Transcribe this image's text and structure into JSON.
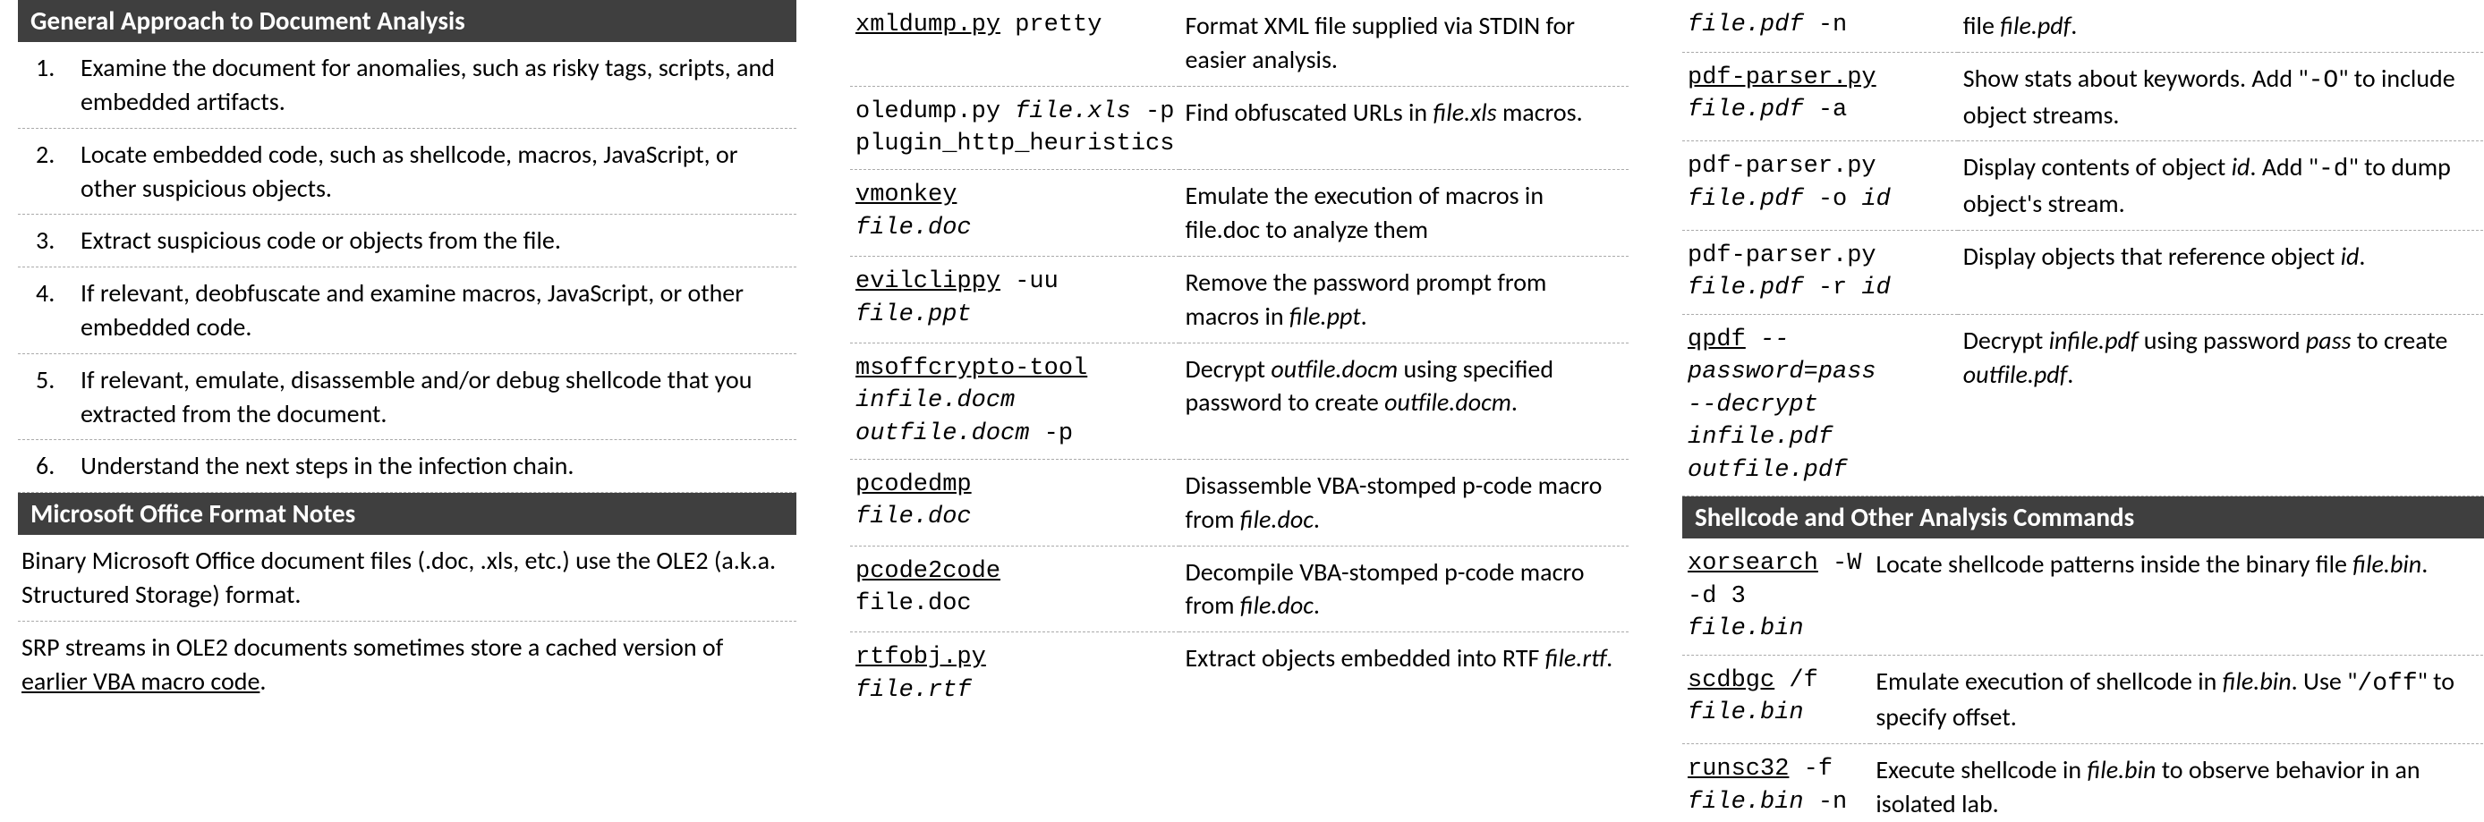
{
  "col1": {
    "header1": "General Approach to Document Analysis",
    "steps": [
      "Examine the document for anomalies, such as risky tags, scripts, and embedded artifacts.",
      "Locate embedded code, such as shellcode, macros, JavaScript, or other suspicious objects.",
      "Extract suspicious code or objects from the file.",
      "If relevant, deobfuscate and examine macros, JavaScript, or other embedded code.",
      "If relevant, emulate, disassemble and/or debug shellcode that you extracted from the document.",
      "Understand the next steps in the infection chain."
    ],
    "header2": "Microsoft Office Format Notes",
    "note1": "Binary Microsoft Office document files (.doc, .xls, etc.) use the OLE2 (a.k.a. Structured Storage) format.",
    "note2_a": "SRP streams in OLE2 documents sometimes store a cached version of ",
    "note2_link": "earlier VBA macro code",
    "note2_b": "."
  },
  "col2": {
    "rows": [
      {
        "tool": "xmldump.py",
        "rest": " pretty",
        "desc": "Format XML file supplied via STDIN for easier analysis."
      },
      {
        "tool": "",
        "plain": "oledump.py ",
        "arg1": "file.xls",
        "rest1": " -p \nplugin_http_heuristics",
        "desc_a": "Find obfuscated URLs in ",
        "desc_em": "file.xls",
        "desc_b": " macros."
      },
      {
        "tool": "vmonkey",
        "rest": "",
        "line2_arg": "file.doc",
        "desc": "Emulate the execution of macros in file.doc to analyze them"
      },
      {
        "tool": "evilclippy",
        "rest": " -uu",
        "line2_arg": "file.ppt",
        "desc_a": "Remove the password prompt from macros in ",
        "desc_em": "file.ppt",
        "desc_b": "."
      },
      {
        "tool": "msoffcrypto-tool",
        "rest": "",
        "line2_arg": "infile.docm",
        "line3_arg": "outfile.docm",
        "line3_rest": " -p",
        "desc_a": "Decrypt ",
        "desc_em": "outfile.docm",
        "desc_b": " using specified password to create ",
        "desc_em2": "outfile.docm",
        "desc_c": "."
      },
      {
        "tool": "pcodedmp",
        "rest": "",
        "line2_arg": "file.doc",
        "desc_a": "Disassemble VBA-stomped p-code macro from ",
        "desc_em": "file.doc",
        "desc_b": "."
      },
      {
        "tool": "pcode2code",
        "rest": "",
        "line2_plain": "file.doc",
        "desc_a": "Decompile VBA-stomped p-code macro from ",
        "desc_em": "file.doc",
        "desc_b": "."
      },
      {
        "tool": "rtfobj.py",
        "rest": "",
        "line2_arg": "file.rtf",
        "desc_a": "Extract objects embedded into RTF ",
        "desc_em": "file.rtf",
        "desc_b": "."
      }
    ]
  },
  "col3": {
    "top_partial": {
      "cmd_arg": "file.pdf",
      "cmd_rest": " -n",
      "desc_a": "file ",
      "desc_em": "file.pdf",
      "desc_b": "."
    },
    "pdf_rows": [
      {
        "tool": "pdf-parser.py",
        "line2_arg": "file.pdf",
        "line2_rest": " -a",
        "desc_a": "Show stats about keywords. Add \"",
        "desc_mono": "-O",
        "desc_b": "\" to include object streams."
      },
      {
        "plain": "pdf-parser.py",
        "line2_arg": "file.pdf",
        "line2_rest": " -o ",
        "line2_arg2": "id",
        "desc_a": "Display contents of object ",
        "desc_em": "id",
        "desc_b": ". Add \"",
        "desc_mono": "-d",
        "desc_c": "\" to dump object's stream."
      },
      {
        "plain": "pdf-parser.py",
        "line2_arg": "file.pdf",
        "line2_rest": " -r ",
        "line2_arg2": "id",
        "desc_a": "Display objects that reference object ",
        "desc_em": "id",
        "desc_b": "."
      },
      {
        "tool": "qpdf",
        "rest_arg": " --password=pass",
        "line2_arg": "--decrypt infile.pdf",
        "line3_arg": "outfile.pdf",
        "desc_a": "Decrypt ",
        "desc_em": "infile.pdf",
        "desc_b": " using password ",
        "desc_em2": "pass",
        "desc_c": " to create ",
        "desc_em3": "outfile.pdf",
        "desc_d": "."
      }
    ],
    "header": "Shellcode and Other Analysis Commands",
    "shell_rows": [
      {
        "tool": "xorsearch",
        "rest": " -W",
        "line2": "-d 3 ",
        "line2_arg": "file.bin",
        "desc_a": "Locate shellcode patterns inside the binary file ",
        "desc_em": "file.bin",
        "desc_b": "."
      },
      {
        "tool": "scdbgc",
        "rest": " /f",
        "line2_arg": "file.bin",
        "desc_a": "Emulate execution of shellcode in ",
        "desc_em": "file.bin",
        "desc_b": ". Use \"",
        "desc_mono": "/off",
        "desc_c": "\" to specify offset."
      },
      {
        "tool": "runsc32",
        "rest": " -f",
        "line2_arg": "file.bin",
        "line2_rest": " -n",
        "desc_a": "Execute shellcode in ",
        "desc_em": "file.bin",
        "desc_b": " to observe behavior in an isolated lab."
      }
    ]
  }
}
